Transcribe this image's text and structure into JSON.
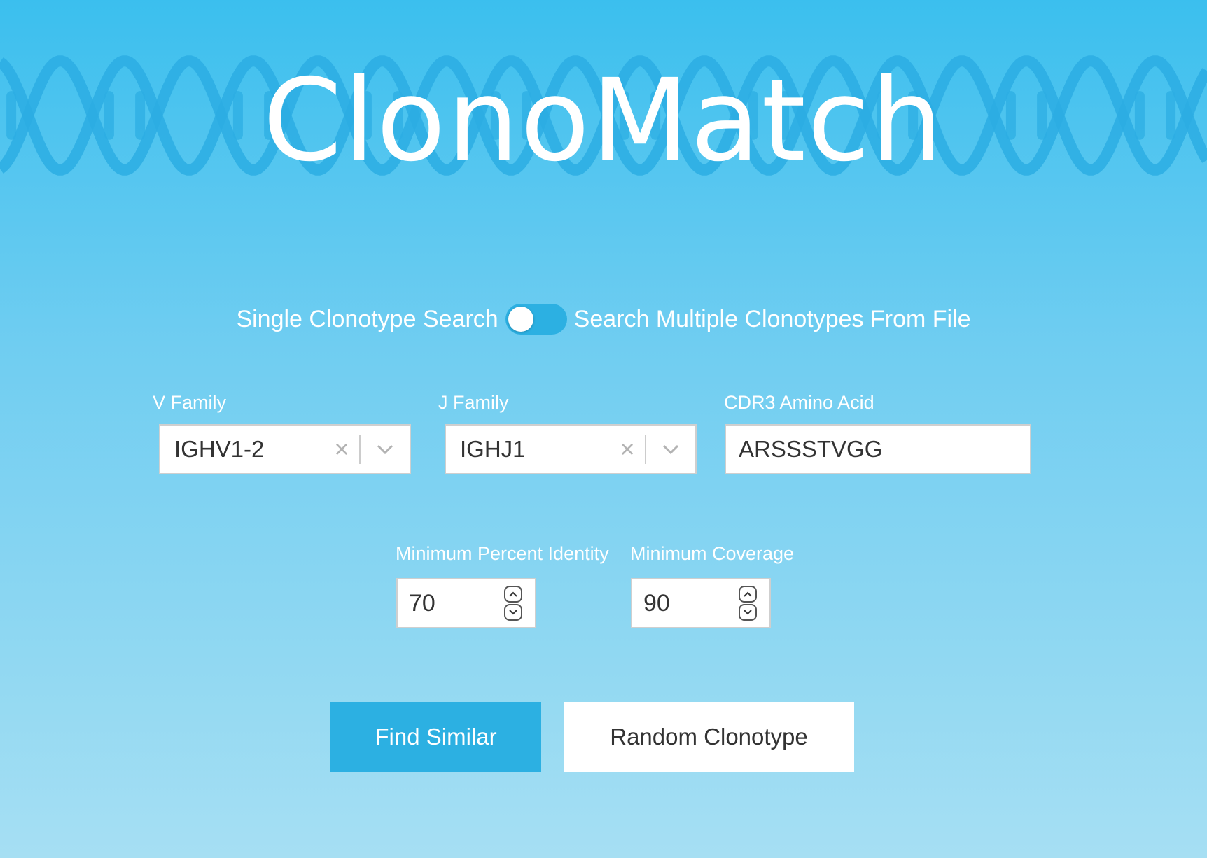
{
  "app": {
    "title": "ClonoMatch"
  },
  "mode": {
    "left_label": "Single Clonotype Search",
    "right_label": "Search Multiple Clonotypes From File",
    "toggle_on": false
  },
  "v_family": {
    "label": "V Family",
    "value": "IGHV1-2",
    "clear_icon": "close-icon",
    "dropdown_icon": "chevron-down-icon"
  },
  "j_family": {
    "label": "J Family",
    "value": "IGHJ1",
    "clear_icon": "close-icon",
    "dropdown_icon": "chevron-down-icon"
  },
  "cdr3": {
    "label": "CDR3 Amino Acid",
    "value": "ARSSSTVGG"
  },
  "min_identity": {
    "label": "Minimum Percent Identity",
    "value": "70"
  },
  "min_coverage": {
    "label": "Minimum Coverage",
    "value": "90"
  },
  "actions": {
    "find_label": "Find Similar",
    "random_label": "Random Clonotype"
  },
  "colors": {
    "accent": "#2cb0e2",
    "background_top": "#3bbfee",
    "background_bottom": "#a6dff3",
    "text_on_accent": "#ffffff"
  }
}
